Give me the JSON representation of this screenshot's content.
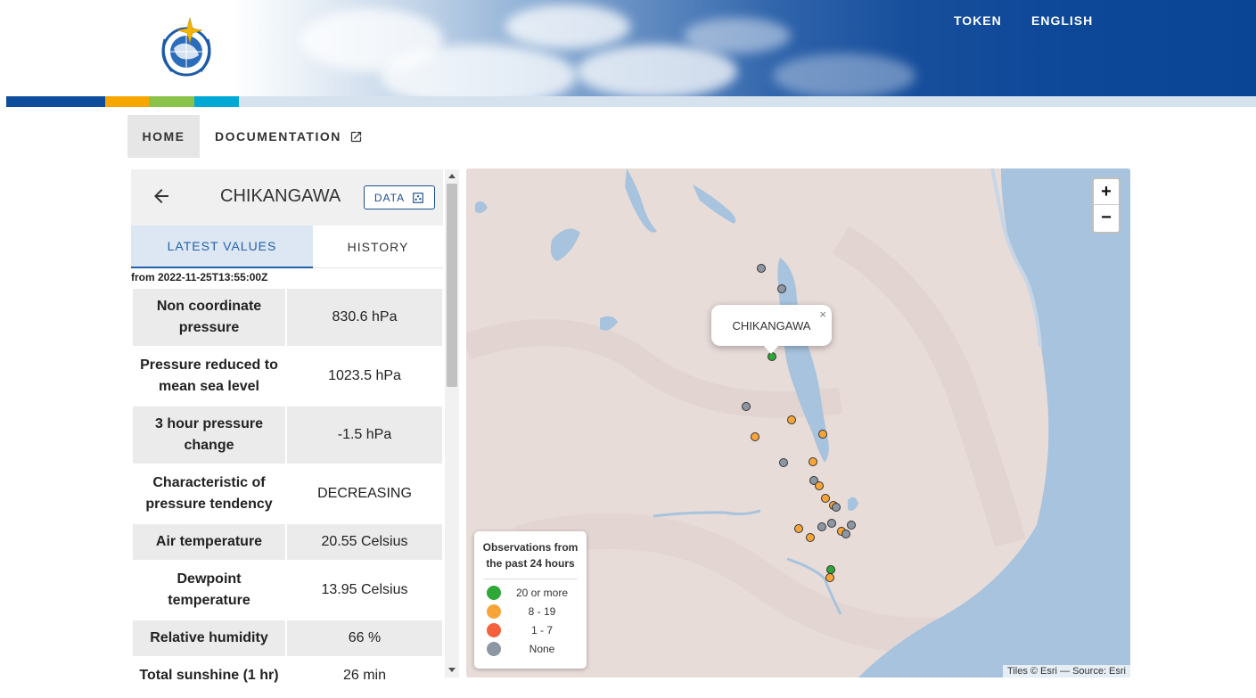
{
  "header": {
    "links": {
      "token": "TOKEN",
      "language": "ENGLISH"
    },
    "logo_icon": "wmo-emblem-icon",
    "stripe_colors": [
      "#0d4d9b",
      "#f7a600",
      "#8bc34a",
      "#00a8d6",
      "#d7e2ef"
    ]
  },
  "nav": {
    "home": "HOME",
    "documentation": "DOCUMENTATION",
    "external_icon": "external-link-icon"
  },
  "station_panel": {
    "station_name": "CHIKANGAWA",
    "data_button": "DATA",
    "tabs": {
      "latest": "LATEST VALUES",
      "history": "HISTORY"
    },
    "from_text": "from 2022-11-25T13:55:00Z",
    "observations": [
      {
        "label": "Non coordinate pressure",
        "value": "830.6 hPa"
      },
      {
        "label": "Pressure reduced to mean sea level",
        "value": "1023.5 hPa"
      },
      {
        "label": "3 hour pressure change",
        "value": "-1.5 hPa"
      },
      {
        "label": "Characteristic of pressure tendency",
        "value": "DECREASING"
      },
      {
        "label": "Air temperature",
        "value": "20.55 Celsius"
      },
      {
        "label": "Dewpoint temperature",
        "value": "13.95 Celsius"
      },
      {
        "label": "Relative humidity",
        "value": "66 %"
      },
      {
        "label": "Total sunshine (1 hr)",
        "value": "26 min"
      }
    ]
  },
  "map": {
    "zoom_in": "+",
    "zoom_out": "−",
    "popup_label": "CHIKANGAWA",
    "popup_close": "×",
    "attribution": "Tiles © Esri — Source: Esri",
    "legend": {
      "title_line1": "Observations from",
      "title_line2": "the past 24 hours",
      "items": [
        {
          "label": "20 or more",
          "color": "#2ea836"
        },
        {
          "label": "8 - 19",
          "color": "#f7a539"
        },
        {
          "label": "1 - 7",
          "color": "#f4603c"
        },
        {
          "label": "None",
          "color": "#8d96a3"
        }
      ]
    },
    "colors": {
      "land": "#e8dcd9",
      "water": "#a7c3dd"
    }
  }
}
